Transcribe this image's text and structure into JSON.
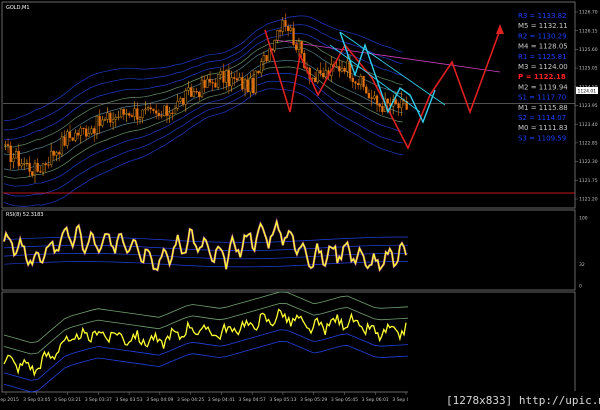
{
  "window": {
    "symbol_label": "GOLD,M1",
    "footer_text": "[1278x833] http://upic.me/"
  },
  "colors": {
    "background": "#000000",
    "candle_up": "#f2a020",
    "candle_down": "#e07010",
    "rsi_line": "#ffff33",
    "zigzag_red": "#e02020",
    "zigzag_cyan": "#30d0f0",
    "band_blue": "#2040e0",
    "band_green": "#70a070",
    "pivot_blue": "#1a40ff",
    "pivot_grey": "#c8c8c8",
    "pivot_red": "#ff2020",
    "magenta": "#d040c0"
  },
  "price_axis": {
    "ticks": [
      "1126.70",
      "1126.15",
      "1125.60",
      "1125.05",
      "1124.50",
      "1123.95",
      "1123.40",
      "1122.85",
      "1122.30",
      "1121.75",
      "1121.20"
    ],
    "current_price": "1124.01"
  },
  "pivot_levels": [
    {
      "label": "R3 = 1133.82",
      "style": "blue"
    },
    {
      "label": "M5 = 1132.11",
      "style": "grey"
    },
    {
      "label": "R2 = 1130.29",
      "style": "blue"
    },
    {
      "label": "M4 = 1128.05",
      "style": "grey"
    },
    {
      "label": "R1 = 1125.81",
      "style": "blue"
    },
    {
      "label": "M3 = 1124.00",
      "style": "grey"
    },
    {
      "label": "P = 1122.18",
      "style": "red"
    },
    {
      "label": "M2 = 1119.94",
      "style": "grey"
    },
    {
      "label": "S1 = 1117.70",
      "style": "blue"
    },
    {
      "label": "M1 = 1115.88",
      "style": "grey"
    },
    {
      "label": "S2 = 1114.07",
      "style": "blue"
    },
    {
      "label": "M0 = 1111.83",
      "style": "grey"
    },
    {
      "label": "S3 = 1109.59",
      "style": "blue"
    }
  ],
  "rsi_pane": {
    "label": "RSI(8) 52.3183",
    "axis_ticks": [
      "100",
      "32",
      "0"
    ]
  },
  "time_axis": [
    "3 Sep 2015",
    "3 Sep 03:05",
    "3 Sep 03:21",
    "3 Sep 03:37",
    "3 Sep 03:53",
    "3 Sep 04:09",
    "3 Sep 04:25",
    "3 Sep 04:41",
    "3 Sep 04:57",
    "3 Sep 05:13",
    "3 Sep 05:29",
    "3 Sep 05:45",
    "3 Sep 06:01",
    "3 Sep 06:17"
  ],
  "chart_data": [
    {
      "type": "line",
      "title": "GOLD,M1",
      "x": [
        "3 Sep 2015",
        "3 Sep 03:05",
        "3 Sep 03:21",
        "3 Sep 03:37",
        "3 Sep 03:53",
        "3 Sep 04:09",
        "3 Sep 04:25",
        "3 Sep 04:41",
        "3 Sep 04:57",
        "3 Sep 05:13",
        "3 Sep 05:29",
        "3 Sep 05:45",
        "3 Sep 06:01",
        "3 Sep 06:17"
      ],
      "series": [
        {
          "values": [
            1122.6,
            1122.0,
            1123.0,
            1123.4,
            1123.8,
            1123.6,
            1124.3,
            1124.8,
            1124.5,
            1126.6,
            1124.7,
            1125.2,
            1124.0,
            1123.9
          ]
        }
      ],
      "ylim": [
        1121.0,
        1126.9
      ],
      "grid": false,
      "current_price": 1124.01
    },
    {
      "type": "line",
      "title": "RSI(8) 52.3183",
      "x": [
        "3 Sep 2015",
        "3 Sep 03:05",
        "3 Sep 03:21",
        "3 Sep 03:37",
        "3 Sep 03:53",
        "3 Sep 04:09",
        "3 Sep 04:25",
        "3 Sep 04:41",
        "3 Sep 04:57",
        "3 Sep 05:13",
        "3 Sep 05:29",
        "3 Sep 05:45",
        "3 Sep 06:01",
        "3 Sep 06:17"
      ],
      "series": [
        {
          "values": [
            70,
            35,
            75,
            60,
            68,
            35,
            70,
            40,
            72,
            80,
            40,
            55,
            30,
            52
          ]
        }
      ],
      "ylim": [
        0,
        100
      ],
      "grid": false
    },
    {
      "type": "line",
      "x": [
        "3 Sep 2015",
        "3 Sep 03:05",
        "3 Sep 03:21",
        "3 Sep 03:37",
        "3 Sep 03:53",
        "3 Sep 04:09",
        "3 Sep 04:25",
        "3 Sep 04:41",
        "3 Sep 04:57",
        "3 Sep 05:13",
        "3 Sep 05:29",
        "3 Sep 05:45",
        "3 Sep 06:01",
        "3 Sep 06:17"
      ],
      "series": [
        {
          "values": [
            0.3,
            0.2,
            0.5,
            0.6,
            0.55,
            0.5,
            0.65,
            0.6,
            0.7,
            0.8,
            0.65,
            0.75,
            0.6,
            0.62
          ]
        }
      ],
      "grid": false
    }
  ]
}
